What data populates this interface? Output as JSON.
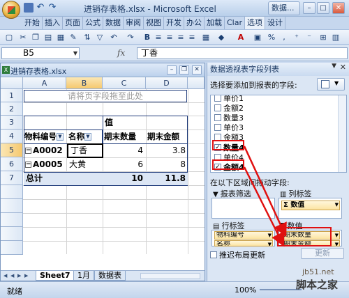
{
  "titlebar": {
    "title": "进销存表格.xlsx - Microsoft Excel",
    "right_button": "数据..."
  },
  "tabs": [
    "开始",
    "插入",
    "页面",
    "公式",
    "数据",
    "审阅",
    "视图",
    "开发",
    "办公",
    "加载",
    "Clar",
    "选项",
    "设计"
  ],
  "formula_bar": {
    "name_box": "B5",
    "fx": "fx",
    "content": "丁香"
  },
  "workbook": {
    "title": "进销存表格.xlsx",
    "columns": [
      "A",
      "B",
      "C",
      "D"
    ],
    "rows": [
      "1",
      "2",
      "3",
      "4",
      "5",
      "6",
      "7"
    ],
    "page_field_hint": "请将页字段拖至此处",
    "values_header": "值",
    "row_label_header": "物料编号",
    "name_header": "名称",
    "qty_header": "期末数量",
    "amount_header": "期末金额",
    "data_rows": [
      {
        "code": "A0002",
        "name": "丁香",
        "qty": "4",
        "amount": "3.8"
      },
      {
        "code": "A0005",
        "name": "大黄",
        "qty": "6",
        "amount": "8"
      }
    ],
    "total": {
      "label": "总计",
      "qty": "10",
      "amount": "11.8"
    },
    "sheet_tabs": [
      "Sheet7",
      "1月",
      "数据表"
    ]
  },
  "status": {
    "ready": "就绪",
    "zoom": "100%"
  },
  "field_pane": {
    "title": "数据透视表字段列表",
    "choose_label": "选择要添加到报表的字段:",
    "fields": [
      {
        "label": "单价1",
        "checked": false
      },
      {
        "label": "金额2",
        "checked": false
      },
      {
        "label": "数量3",
        "checked": false
      },
      {
        "label": "单价3",
        "checked": false
      },
      {
        "label": "金额3",
        "checked": false
      },
      {
        "label": "数量4",
        "checked": true
      },
      {
        "label": "单价4",
        "checked": false
      },
      {
        "label": "金额4",
        "checked": true
      }
    ],
    "drag_label": "在以下区域间拖动字段:",
    "report_filter": "报表筛选",
    "column_labels": "列标签",
    "column_chip": "Σ 数值",
    "row_labels": "行标签",
    "values": "数值",
    "row_chips": [
      "物料编号",
      "名称"
    ],
    "value_chips": [
      "期末数量",
      "期末金额"
    ],
    "defer_label": "推迟布局更新",
    "update_button": "更新"
  },
  "watermark": {
    "line1": "jb51.net",
    "line2": "脚本之家"
  },
  "colors": {
    "pivot_border": "#1f3b7a",
    "highlight_red": "#e01010",
    "ribbon_blue": "#c6d7ee"
  }
}
